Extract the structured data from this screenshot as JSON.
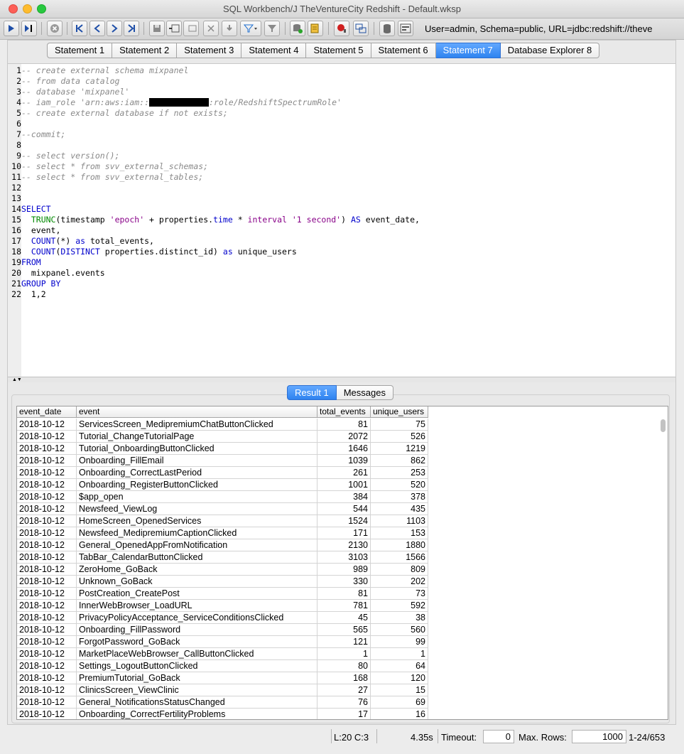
{
  "window": {
    "title": "SQL Workbench/J TheVentureCity Redshift - Default.wksp"
  },
  "toolbar": {
    "connection_info": "User=admin, Schema=public, URL=jdbc:redshift://theve"
  },
  "tabs": [
    {
      "label": "Statement 1",
      "active": false
    },
    {
      "label": "Statement 2",
      "active": false
    },
    {
      "label": "Statement 3",
      "active": false
    },
    {
      "label": "Statement 4",
      "active": false
    },
    {
      "label": "Statement 5",
      "active": false
    },
    {
      "label": "Statement 6",
      "active": false
    },
    {
      "label": "Statement 7",
      "active": true
    },
    {
      "label": "Database Explorer 8",
      "active": false
    }
  ],
  "editor": {
    "lines": [
      {
        "n": "1",
        "segs": [
          {
            "t": "-- create external schema mixpanel",
            "c": "cm"
          }
        ]
      },
      {
        "n": "2",
        "segs": [
          {
            "t": "-- from data catalog",
            "c": "cm"
          }
        ]
      },
      {
        "n": "3",
        "segs": [
          {
            "t": "-- database 'mixpanel'",
            "c": "cm"
          }
        ]
      },
      {
        "n": "4",
        "segs": [
          {
            "t": "-- iam_role 'arn:aws:iam::",
            "c": "cm"
          },
          {
            "t": "",
            "c": "redact"
          },
          {
            "t": ":role/RedshiftSpectrumRole'",
            "c": "cm"
          }
        ]
      },
      {
        "n": "5",
        "segs": [
          {
            "t": "-- create external database if not exists;",
            "c": "cm"
          }
        ]
      },
      {
        "n": "6",
        "segs": []
      },
      {
        "n": "7",
        "segs": [
          {
            "t": "--commit;",
            "c": "cm"
          }
        ]
      },
      {
        "n": "8",
        "segs": []
      },
      {
        "n": "9",
        "segs": [
          {
            "t": "-- select version();",
            "c": "cm"
          }
        ]
      },
      {
        "n": "10",
        "segs": [
          {
            "t": "-- select * from svv_external_schemas;",
            "c": "cm"
          }
        ]
      },
      {
        "n": "11",
        "segs": [
          {
            "t": "-- select * from svv_external_tables;",
            "c": "cm"
          }
        ]
      },
      {
        "n": "12",
        "segs": []
      },
      {
        "n": "13",
        "segs": []
      },
      {
        "n": "14",
        "segs": [
          {
            "t": "SELECT",
            "c": "kw"
          }
        ]
      },
      {
        "n": "15",
        "segs": [
          {
            "t": "  ",
            "c": ""
          },
          {
            "t": "TRUNC",
            "c": "fn"
          },
          {
            "t": "(timestamp ",
            "c": ""
          },
          {
            "t": "'epoch'",
            "c": "st"
          },
          {
            "t": " + properties.",
            "c": ""
          },
          {
            "t": "time",
            "c": "kw"
          },
          {
            "t": " * ",
            "c": ""
          },
          {
            "t": "interval",
            "c": "st"
          },
          {
            "t": " ",
            "c": ""
          },
          {
            "t": "'1 second'",
            "c": "st"
          },
          {
            "t": ") ",
            "c": ""
          },
          {
            "t": "AS",
            "c": "kw"
          },
          {
            "t": " event_date,",
            "c": ""
          }
        ]
      },
      {
        "n": "16",
        "segs": [
          {
            "t": "  event,",
            "c": ""
          }
        ]
      },
      {
        "n": "17",
        "segs": [
          {
            "t": "  ",
            "c": ""
          },
          {
            "t": "COUNT",
            "c": "kw"
          },
          {
            "t": "(*) ",
            "c": ""
          },
          {
            "t": "as",
            "c": "kw"
          },
          {
            "t": " total_events,",
            "c": ""
          }
        ]
      },
      {
        "n": "18",
        "segs": [
          {
            "t": "  ",
            "c": ""
          },
          {
            "t": "COUNT",
            "c": "kw"
          },
          {
            "t": "(",
            "c": ""
          },
          {
            "t": "DISTINCT",
            "c": "kw"
          },
          {
            "t": " properties.distinct_id) ",
            "c": ""
          },
          {
            "t": "as",
            "c": "kw"
          },
          {
            "t": " unique_users",
            "c": ""
          }
        ]
      },
      {
        "n": "19",
        "segs": [
          {
            "t": "FROM",
            "c": "kw"
          }
        ]
      },
      {
        "n": "20",
        "segs": [
          {
            "t": "  mixpanel.events",
            "c": ""
          }
        ]
      },
      {
        "n": "21",
        "segs": [
          {
            "t": "GROUP BY",
            "c": "kw"
          }
        ]
      },
      {
        "n": "22",
        "segs": [
          {
            "t": "  1,2",
            "c": ""
          }
        ]
      }
    ]
  },
  "results": {
    "tabs": [
      "Result 1",
      "Messages"
    ],
    "columns": [
      "event_date",
      "event",
      "total_events",
      "unique_users"
    ],
    "rows": [
      [
        "2018-10-12",
        "ServicesScreen_MedipremiumChatButtonClicked",
        "81",
        "75"
      ],
      [
        "2018-10-12",
        "Tutorial_ChangeTutorialPage",
        "2072",
        "526"
      ],
      [
        "2018-10-12",
        "Tutorial_OnboardingButtonClicked",
        "1646",
        "1219"
      ],
      [
        "2018-10-12",
        "Onboarding_FillEmail",
        "1039",
        "862"
      ],
      [
        "2018-10-12",
        "Onboarding_CorrectLastPeriod",
        "261",
        "253"
      ],
      [
        "2018-10-12",
        "Onboarding_RegisterButtonClicked",
        "1001",
        "520"
      ],
      [
        "2018-10-12",
        "$app_open",
        "384",
        "378"
      ],
      [
        "2018-10-12",
        "Newsfeed_ViewLog",
        "544",
        "435"
      ],
      [
        "2018-10-12",
        "HomeScreen_OpenedServices",
        "1524",
        "1103"
      ],
      [
        "2018-10-12",
        "Newsfeed_MedipremiumCaptionClicked",
        "171",
        "153"
      ],
      [
        "2018-10-12",
        "General_OpenedAppFromNotification",
        "2130",
        "1880"
      ],
      [
        "2018-10-12",
        "TabBar_CalendarButtonClicked",
        "3103",
        "1566"
      ],
      [
        "2018-10-12",
        "ZeroHome_GoBack",
        "989",
        "809"
      ],
      [
        "2018-10-12",
        "Unknown_GoBack",
        "330",
        "202"
      ],
      [
        "2018-10-12",
        "PostCreation_CreatePost",
        "81",
        "73"
      ],
      [
        "2018-10-12",
        "InnerWebBrowser_LoadURL",
        "781",
        "592"
      ],
      [
        "2018-10-12",
        "PrivacyPolicyAcceptance_ServiceConditionsClicked",
        "45",
        "38"
      ],
      [
        "2018-10-12",
        "Onboarding_FillPassword",
        "565",
        "560"
      ],
      [
        "2018-10-12",
        "ForgotPassword_GoBack",
        "121",
        "99"
      ],
      [
        "2018-10-12",
        "MarketPlaceWebBrowser_CallButtonClicked",
        "1",
        "1"
      ],
      [
        "2018-10-12",
        "Settings_LogoutButtonClicked",
        "80",
        "64"
      ],
      [
        "2018-10-12",
        "PremiumTutorial_GoBack",
        "168",
        "120"
      ],
      [
        "2018-10-12",
        "ClinicsScreen_ViewClinic",
        "27",
        "15"
      ],
      [
        "2018-10-12",
        "General_NotificationsStatusChanged",
        "76",
        "69"
      ],
      [
        "2018-10-12",
        "Onboarding_CorrectFertilityProblems",
        "17",
        "16"
      ]
    ]
  },
  "status": {
    "cursor": "L:20 C:3",
    "exec_time": "4.35s",
    "timeout_label": "Timeout:",
    "timeout_value": "0",
    "maxrows_label": "Max. Rows:",
    "maxrows_value": "1000",
    "range": "1-24/653"
  }
}
